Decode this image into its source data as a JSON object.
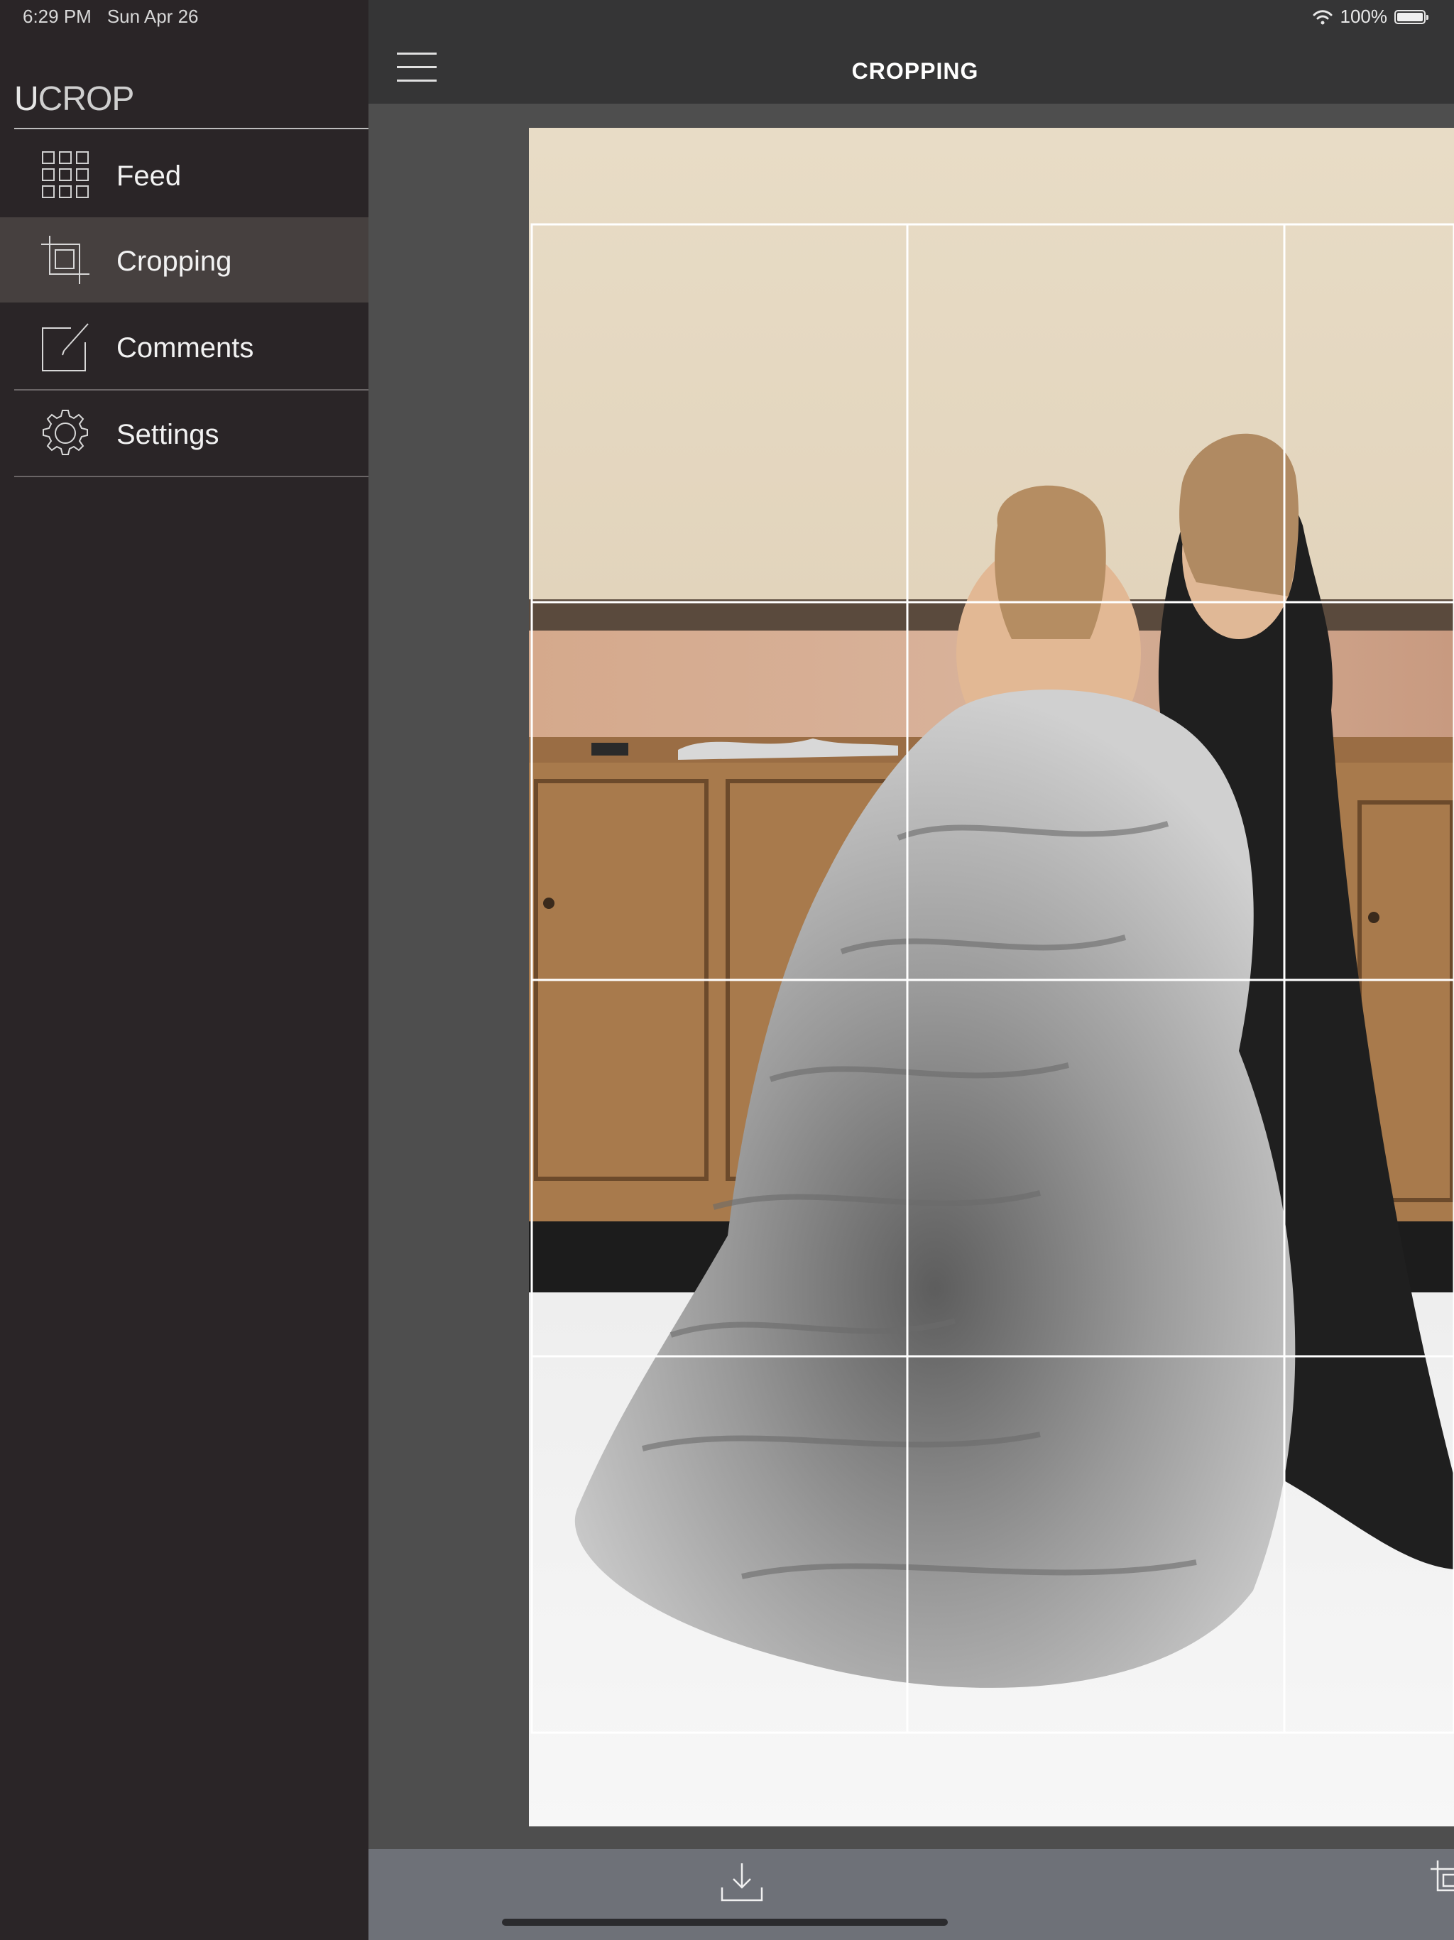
{
  "status_bar": {
    "time": "6:29 PM",
    "date": "Sun Apr 26",
    "battery": "100%",
    "wifi_icon": "wifi-icon",
    "battery_icon": "battery-icon"
  },
  "sidebar": {
    "logo": {
      "first_letter": "U",
      "rest": "CROP"
    },
    "items": [
      {
        "label": "Feed",
        "icon": "grid-icon",
        "active": false
      },
      {
        "label": "Cropping",
        "icon": "crop-icon",
        "active": true
      },
      {
        "label": "Comments",
        "icon": "edit-icon",
        "active": false
      },
      {
        "label": "Settings",
        "icon": "gear-icon",
        "active": false
      }
    ]
  },
  "header": {
    "title": "CROPPING",
    "menu_icon": "hamburger-menu-icon"
  },
  "toolbar": {
    "download_icon": "download-icon",
    "crop_icon": "crop-icon"
  },
  "colors": {
    "sidebar_bg": "#2a2527",
    "sidebar_active": "#46403f",
    "topbar_bg": "#353536",
    "workspace_bg": "#4e4e4e",
    "bottombar_bg": "#6e7178"
  }
}
